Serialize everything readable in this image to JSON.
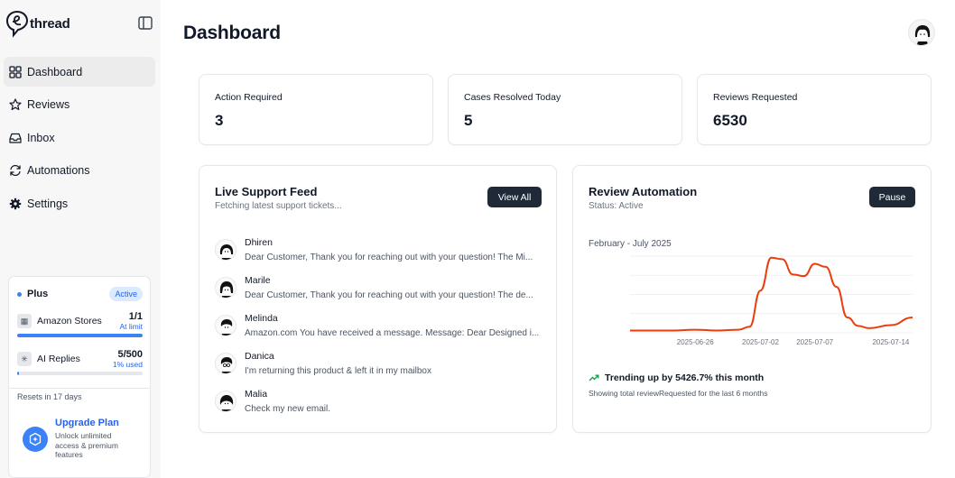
{
  "brand": {
    "name": "thread"
  },
  "nav": {
    "items": [
      {
        "label": "Dashboard",
        "icon": "grid-icon",
        "active": true
      },
      {
        "label": "Reviews",
        "icon": "star-icon"
      },
      {
        "label": "Inbox",
        "icon": "inbox-icon"
      },
      {
        "label": "Automations",
        "icon": "refresh-icon"
      },
      {
        "label": "Settings",
        "icon": "gear-icon"
      }
    ]
  },
  "plan": {
    "name": "Plus",
    "status": "Active",
    "usage": [
      {
        "label": "Amazon Stores",
        "count": "1/1",
        "note": "At limit",
        "fill": 1.0
      },
      {
        "label": "AI Replies",
        "count": "5/500",
        "note": "1% used",
        "fill": 0.01
      }
    ],
    "resets": "Resets in 17 days",
    "upgrade_title": "Upgrade Plan",
    "upgrade_desc": "Unlock unlimited access & premium features"
  },
  "page": {
    "title": "Dashboard"
  },
  "stats": [
    {
      "label": "Action Required",
      "value": "3"
    },
    {
      "label": "Cases Resolved Today",
      "value": "5"
    },
    {
      "label": "Reviews Requested",
      "value": "6530"
    }
  ],
  "feed": {
    "title": "Live Support Feed",
    "subtitle": "Fetching latest support tickets...",
    "button": "View All",
    "items": [
      {
        "name": "Dhiren",
        "message": "Dear Customer, Thank you for reaching out with your question! The Mi..."
      },
      {
        "name": "Marile",
        "message": "Dear Customer, Thank you for reaching out with your question! The de..."
      },
      {
        "name": "Melinda",
        "message": "Amazon.com You have received a message. Message: Dear Designed i..."
      },
      {
        "name": "Danica",
        "message": "I'm returning this product & left it in my mailbox"
      },
      {
        "name": "Malia",
        "message": "Check my new email."
      }
    ]
  },
  "automation": {
    "title": "Review Automation",
    "subtitle": "Status: Active",
    "button": "Pause",
    "range": "February - July 2025",
    "trend": "Trending up by 5426.7% this month",
    "note": "Showing total reviewRequested for the last 6 months"
  },
  "chart_data": {
    "type": "line",
    "x_ticks": [
      "2025-06-26",
      "2025-07-02",
      "2025-07-07",
      "2025-07-14"
    ],
    "series": [
      {
        "color": "#ea3e0c",
        "x": [
          "2025-06-20",
          "2025-06-22",
          "2025-06-24",
          "2025-06-26",
          "2025-06-28",
          "2025-06-30",
          "2025-07-01",
          "2025-07-02",
          "2025-07-03",
          "2025-07-04",
          "2025-07-05",
          "2025-07-06",
          "2025-07-07",
          "2025-07-08",
          "2025-07-09",
          "2025-07-10",
          "2025-07-11",
          "2025-07-12",
          "2025-07-14",
          "2025-07-16"
        ],
        "values": [
          3,
          3,
          3,
          4,
          3,
          4,
          8,
          55,
          98,
          96,
          76,
          74,
          90,
          86,
          60,
          20,
          9,
          6,
          10,
          20
        ]
      }
    ],
    "ylim": [
      0,
      100
    ],
    "grid": true
  }
}
